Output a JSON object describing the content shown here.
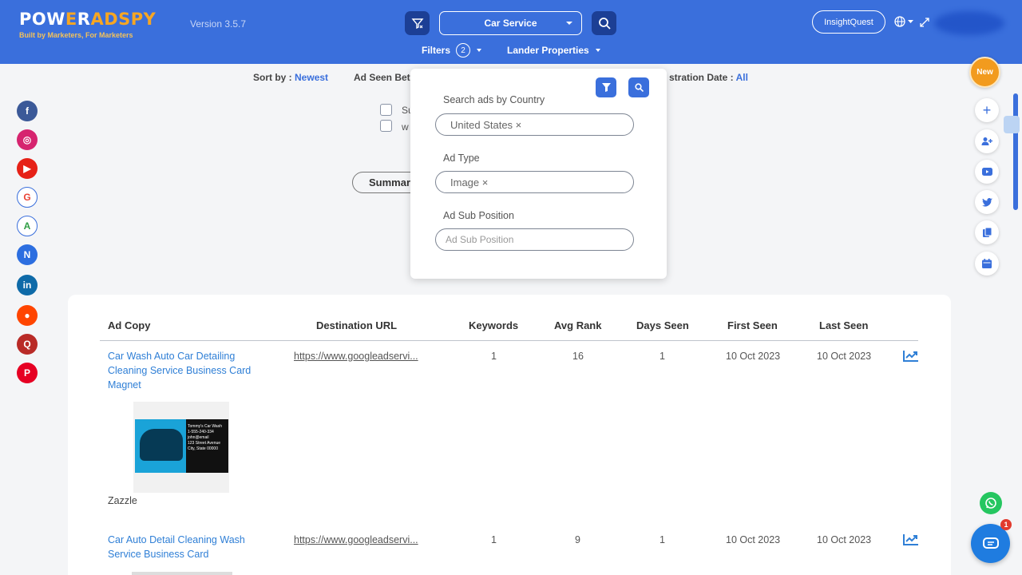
{
  "header": {
    "logo_pre": "POW",
    "logo_accent": "E",
    "logo_post": "R",
    "logo_brand": "ADSPY",
    "tagline": "Built by Marketers, For Marketers",
    "version": "Version 3.5.7",
    "keyword": "Car Service",
    "filters_label": "Filters",
    "filters_count": "2",
    "lander_label": "Lander Properties",
    "insight_label": "InsightQuest"
  },
  "sortbar": {
    "sort_label": "Sort by :",
    "sort_value": "Newest",
    "ad_seen_label": "Ad Seen Bet",
    "reg_label": "stration Date :",
    "reg_value": "All",
    "check1": "Su",
    "check2": "w",
    "summary_label": "Summar"
  },
  "social": [
    {
      "name": "facebook",
      "color": "#3b5998",
      "glyph": "f"
    },
    {
      "name": "instagram",
      "color": "#d6246f",
      "glyph": "◎"
    },
    {
      "name": "youtube",
      "color": "#e62117",
      "glyph": "▶"
    },
    {
      "name": "google",
      "color": "#ffffff",
      "glyph": "G"
    },
    {
      "name": "google-ads",
      "color": "#ffffff",
      "glyph": "A"
    },
    {
      "name": "native",
      "color": "#2c6ee0",
      "glyph": "N"
    },
    {
      "name": "linkedin",
      "color": "#0e6aa8",
      "glyph": "in"
    },
    {
      "name": "reddit",
      "color": "#ff4500",
      "glyph": "●"
    },
    {
      "name": "quora",
      "color": "#b92b27",
      "glyph": "Q"
    },
    {
      "name": "pinterest",
      "color": "#e60023",
      "glyph": "P"
    }
  ],
  "new_badge": "New",
  "popup": {
    "country_label": "Search ads by Country",
    "country_value": "United States ×",
    "adtype_label": "Ad Type",
    "adtype_value": "Image ×",
    "subpos_label": "Ad Sub Position",
    "subpos_placeholder": "Ad Sub Position"
  },
  "table": {
    "columns": [
      "Ad Copy",
      "Destination URL",
      "Keywords",
      "Avg Rank",
      "Days Seen",
      "First Seen",
      "Last Seen"
    ],
    "rows": [
      {
        "ad_copy": "Car Wash Auto Car Detailing Cleaning Service Business Card Magnet",
        "url": "https://www.googleadservi...",
        "keywords": "1",
        "avg_rank": "16",
        "days_seen": "1",
        "first_seen": "10 Oct 2023",
        "last_seen": "10 Oct 2023",
        "brand": "Zazzle"
      },
      {
        "ad_copy": "Car Auto Detail Cleaning Wash Service Business Card",
        "url": "https://www.googleadservi...",
        "keywords": "1",
        "avg_rank": "9",
        "days_seen": "1",
        "first_seen": "10 Oct 2023",
        "last_seen": "10 Oct 2023"
      }
    ]
  },
  "thumb_text": "Tommy's Car Wash\n1-555-240-334\njohn@email\n123 Street Avenue\nCity, State 00000",
  "chat_badge": "1",
  "colors": {
    "primary": "#3a6fdc",
    "dark_btn": "#1c3f95",
    "link": "#2f7fd6",
    "accent": "#f6a623"
  }
}
